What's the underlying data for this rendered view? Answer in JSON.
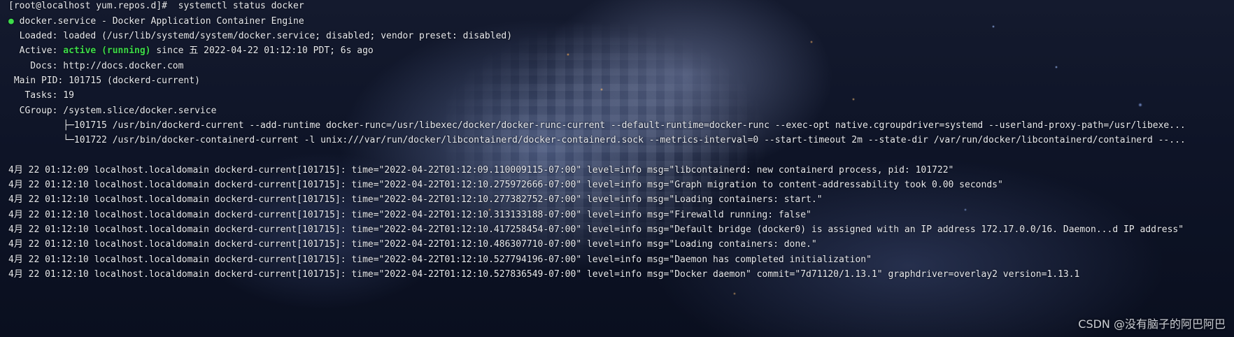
{
  "terminal": {
    "prompt_line": "[root@localhost yum.repos.d]#  systemctl status docker",
    "status_dot": "●",
    "service_line": " docker.service - Docker Application Container Engine",
    "loaded_line": "  Loaded: loaded (/usr/lib/systemd/system/docker.service; disabled; vendor preset: disabled)",
    "active_prefix": "  Active: ",
    "active_status": "active (running)",
    "active_suffix": " since 五 2022-04-22 01:12:10 PDT; 6s ago",
    "docs_line": "    Docs: http://docs.docker.com",
    "mainpid_line": " Main PID: 101715 (dockerd-current)",
    "tasks_line": "   Tasks: 19",
    "cgroup_line": "  CGroup: /system.slice/docker.service",
    "cgroup_child_1": "          ├─101715 /usr/bin/dockerd-current --add-runtime docker-runc=/usr/libexec/docker/docker-runc-current --default-runtime=docker-runc --exec-opt native.cgroupdriver=systemd --userland-proxy-path=/usr/libexe...",
    "cgroup_child_2": "          └─101722 /usr/bin/docker-containerd-current -l unix:///var/run/docker/libcontainerd/docker-containerd.sock --metrics-interval=0 --start-timeout 2m --state-dir /var/run/docker/libcontainerd/containerd --...",
    "log_lines": [
      "4月 22 01:12:09 localhost.localdomain dockerd-current[101715]: time=\"2022-04-22T01:12:09.110009115-07:00\" level=info msg=\"libcontainerd: new containerd process, pid: 101722\"",
      "4月 22 01:12:10 localhost.localdomain dockerd-current[101715]: time=\"2022-04-22T01:12:10.275972666-07:00\" level=info msg=\"Graph migration to content-addressability took 0.00 seconds\"",
      "4月 22 01:12:10 localhost.localdomain dockerd-current[101715]: time=\"2022-04-22T01:12:10.277382752-07:00\" level=info msg=\"Loading containers: start.\"",
      "4月 22 01:12:10 localhost.localdomain dockerd-current[101715]: time=\"2022-04-22T01:12:10.313133188-07:00\" level=info msg=\"Firewalld running: false\"",
      "4月 22 01:12:10 localhost.localdomain dockerd-current[101715]: time=\"2022-04-22T01:12:10.417258454-07:00\" level=info msg=\"Default bridge (docker0) is assigned with an IP address 172.17.0.0/16. Daemon...d IP address\"",
      "4月 22 01:12:10 localhost.localdomain dockerd-current[101715]: time=\"2022-04-22T01:12:10.486307710-07:00\" level=info msg=\"Loading containers: done.\"",
      "4月 22 01:12:10 localhost.localdomain dockerd-current[101715]: time=\"2022-04-22T01:12:10.527794196-07:00\" level=info msg=\"Daemon has completed initialization\"",
      "4月 22 01:12:10 localhost.localdomain dockerd-current[101715]: time=\"2022-04-22T01:12:10.527836549-07:00\" level=info msg=\"Docker daemon\" commit=\"7d71120/1.13.1\" graphdriver=overlay2 version=1.13.1"
    ]
  },
  "watermark": "CSDN @没有脑子的阿巴阿巴",
  "colors": {
    "text": "#e8eaef",
    "active_green": "#3ddc4a",
    "background": "#0b1020"
  }
}
